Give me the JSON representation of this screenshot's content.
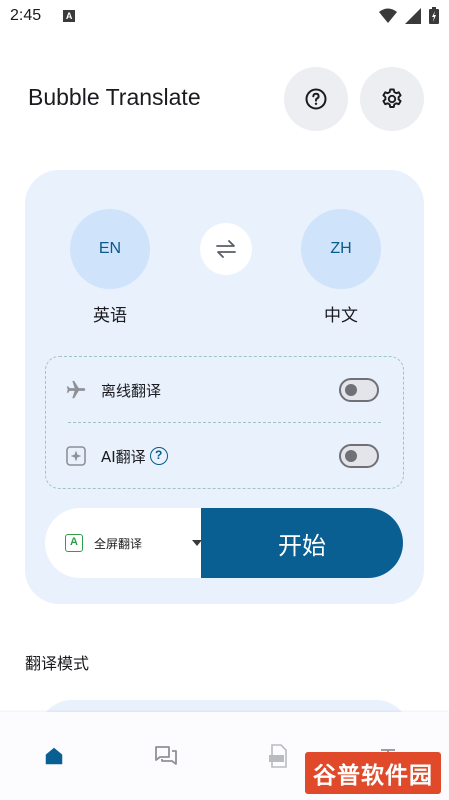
{
  "status_bar": {
    "time": "2:45",
    "notification_badge": "A"
  },
  "header": {
    "title": "Bubble Translate",
    "help_icon": "help-circle-icon",
    "settings_icon": "gear-icon"
  },
  "languages": {
    "source_code": "EN",
    "source_name": "英语",
    "target_code": "ZH",
    "target_name": "中文",
    "swap_icon": "swap-arrows-icon"
  },
  "options": [
    {
      "label": "离线翻译",
      "icon": "airplane-icon",
      "enabled": false
    },
    {
      "label": "AI翻译",
      "icon": "sparkle-icon",
      "enabled": false,
      "help": "?"
    }
  ],
  "mode": {
    "icon_letter": "A",
    "selected": "全屏翻译"
  },
  "start_label": "开始",
  "section_title": "翻译模式",
  "bottom_nav": [
    {
      "name": "home",
      "icon": "home-icon",
      "active": true
    },
    {
      "name": "chat",
      "icon": "chat-bubbles-icon",
      "active": false
    },
    {
      "name": "pdf",
      "icon": "pdf-file-icon",
      "active": false
    },
    {
      "name": "text",
      "icon": "text-icon",
      "active": false
    }
  ],
  "watermark": "谷普软件园",
  "colors": {
    "primary": "#0a5f92",
    "card_bg": "#e8f1fc",
    "lang_circle": "#cfe3fb",
    "dashed_border": "#9fc5c0"
  }
}
